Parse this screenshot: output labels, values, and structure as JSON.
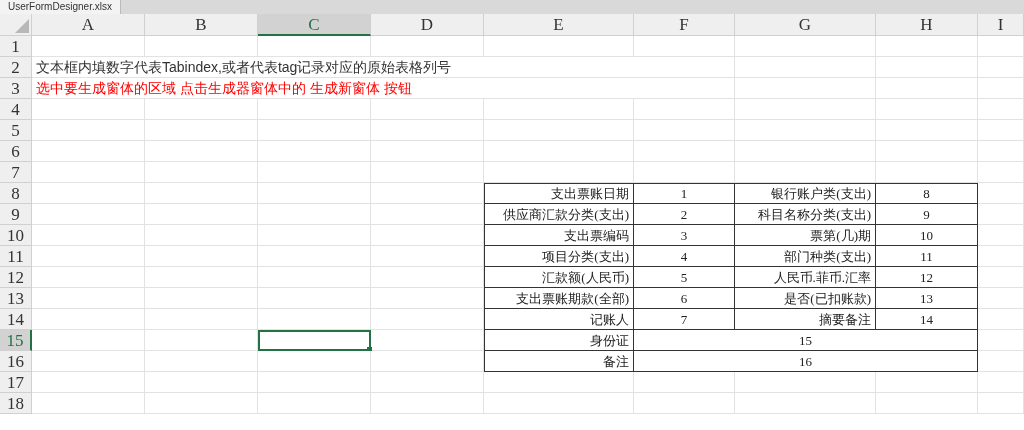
{
  "file_tab": {
    "title": "UserFormDesigner.xlsx"
  },
  "columns": [
    {
      "label": "A",
      "selected": false
    },
    {
      "label": "B",
      "selected": false
    },
    {
      "label": "C",
      "selected": true
    },
    {
      "label": "D",
      "selected": false
    },
    {
      "label": "E",
      "selected": false
    },
    {
      "label": "F",
      "selected": false
    },
    {
      "label": "G",
      "selected": false
    },
    {
      "label": "H",
      "selected": false
    },
    {
      "label": "I",
      "selected": false
    }
  ],
  "rows": [
    {
      "label": "1",
      "selected": false
    },
    {
      "label": "2",
      "selected": false
    },
    {
      "label": "3",
      "selected": false
    },
    {
      "label": "4",
      "selected": false
    },
    {
      "label": "5",
      "selected": false
    },
    {
      "label": "6",
      "selected": false
    },
    {
      "label": "7",
      "selected": false
    },
    {
      "label": "8",
      "selected": false
    },
    {
      "label": "9",
      "selected": false
    },
    {
      "label": "10",
      "selected": false
    },
    {
      "label": "11",
      "selected": false
    },
    {
      "label": "12",
      "selected": false
    },
    {
      "label": "13",
      "selected": false
    },
    {
      "label": "14",
      "selected": false
    },
    {
      "label": "15",
      "selected": true
    },
    {
      "label": "16",
      "selected": false
    },
    {
      "label": "17",
      "selected": false
    },
    {
      "label": "18",
      "selected": false
    }
  ],
  "notes": [
    {
      "text": "文本框内填数字代表Tabindex,或者代表tag记录对应的原始表格列号",
      "color": "#333333"
    },
    {
      "text": "选中要生成窗体的区域 点击生成器窗体中的 生成新窗体 按钮",
      "color": "#ff0000"
    }
  ],
  "form_table": [
    {
      "kind": "pair",
      "cells": [
        "支出票账日期",
        "1",
        "银行账户类(支出)",
        "8"
      ]
    },
    {
      "kind": "pair",
      "cells": [
        "供应商汇款分类(支出)",
        "2",
        "科目名称分类(支出)",
        "9"
      ]
    },
    {
      "kind": "pair",
      "cells": [
        "支出票编码",
        "3",
        "票第(几)期",
        "10"
      ]
    },
    {
      "kind": "pair",
      "cells": [
        "项目分类(支出)",
        "4",
        "部门种类(支出)",
        "11"
      ]
    },
    {
      "kind": "pair",
      "cells": [
        "汇款额(人民币)",
        "5",
        "人民币.菲币.汇率",
        "12"
      ]
    },
    {
      "kind": "pair",
      "cells": [
        "支出票账期款(全部)",
        "6",
        "是否(已扣账款)",
        "13"
      ]
    },
    {
      "kind": "pair",
      "cells": [
        "记账人",
        "7",
        "摘要备注",
        "14"
      ]
    },
    {
      "kind": "merged",
      "cells": [
        "身份证",
        "15"
      ]
    },
    {
      "kind": "merged",
      "cells": [
        "备注",
        "16"
      ]
    }
  ]
}
